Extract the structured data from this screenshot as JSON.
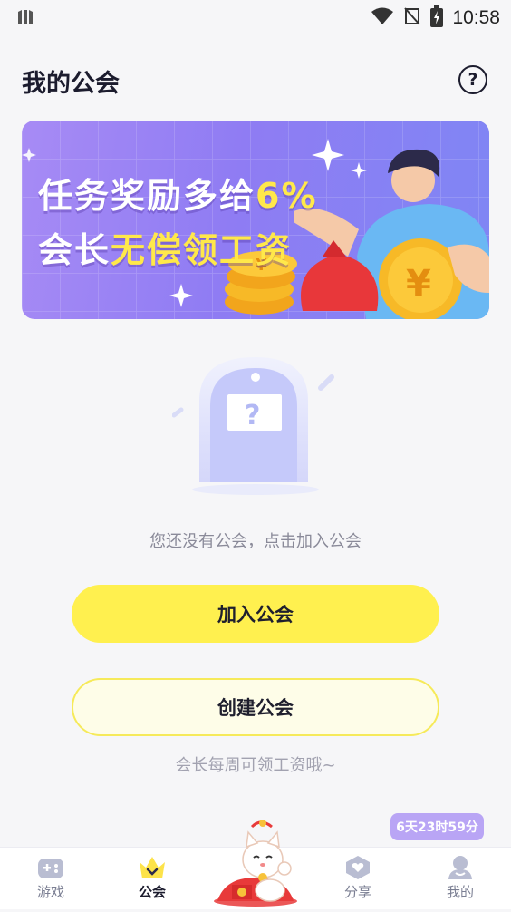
{
  "status_bar": {
    "time": "10:58"
  },
  "header": {
    "title": "我的公会",
    "help_icon": "help-circle-icon"
  },
  "banner": {
    "line1_prefix": "任务奖励多给",
    "line1_highlight": "6%",
    "line2_prefix": "会长",
    "line2_highlight": "无偿领工资",
    "highlight_color": "#ffe84a"
  },
  "empty_state": {
    "message": "您还没有公会，点击加入公会"
  },
  "buttons": {
    "join": "加入公会",
    "create": "创建公会"
  },
  "tip": "会长每周可领工资哦~",
  "countdown": "6天23时59分",
  "tabs": [
    {
      "label": "游戏",
      "icon": "gamepad-icon"
    },
    {
      "label": "公会",
      "icon": "crown-icon",
      "active": true
    },
    {
      "label": "",
      "icon": "lucky-cat-icon"
    },
    {
      "label": "分享",
      "icon": "share-heart-icon"
    },
    {
      "label": "我的",
      "icon": "person-icon"
    }
  ],
  "colors": {
    "accent_yellow": "#fff04f",
    "banner_purple": "#8f7cf3",
    "countdown_purple": "#b9a5f5"
  }
}
